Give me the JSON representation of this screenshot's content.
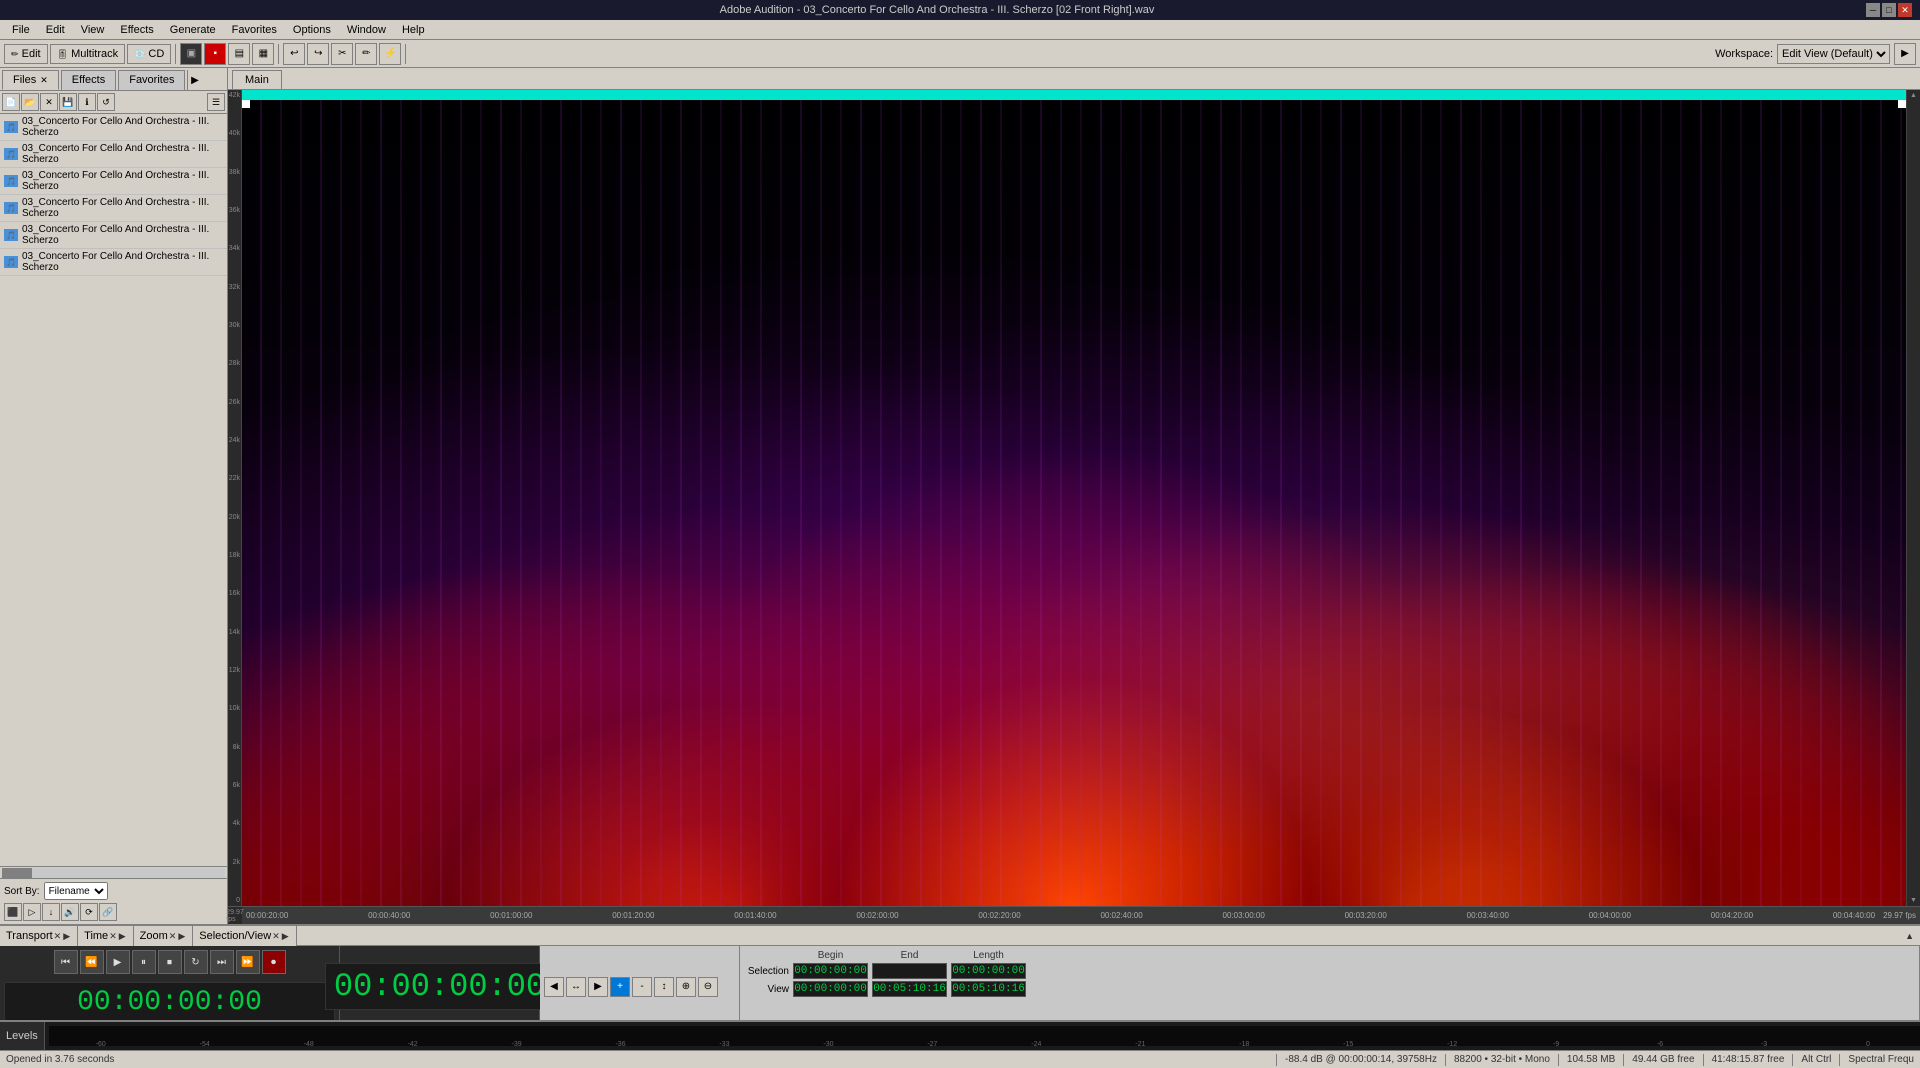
{
  "window": {
    "title": "Adobe Audition - 03_Concerto For Cello And Orchestra - III. Scherzo [02 Front Right].wav",
    "minimize": "─",
    "maximize": "□",
    "close": "✕"
  },
  "menu": {
    "items": [
      "File",
      "Edit",
      "View",
      "Effects",
      "Generate",
      "Favorites",
      "Options",
      "Window",
      "Help"
    ]
  },
  "toolbar": {
    "mode_edit": "Edit",
    "mode_multitrack": "Multitrack",
    "mode_cd": "CD",
    "workspace_label": "Workspace:",
    "workspace_value": "Edit View (Default)"
  },
  "panel": {
    "tabs": [
      {
        "label": "Files",
        "closeable": true
      },
      {
        "label": "Effects",
        "closeable": false
      },
      {
        "label": "Favorites",
        "closeable": false
      }
    ],
    "sort_label": "Sort By:",
    "sort_value": "Filename",
    "files": [
      "03_Concerto For Cello And Orchestra - III. Scherzo",
      "03_Concerto For Cello And Orchestra - III. Scherzo",
      "03_Concerto For Cello And Orchestra - III. Scherzo",
      "03_Concerto For Cello And Orchestra - III. Scherzo",
      "03_Concerto For Cello And Orchestra - III. Scherzo",
      "03_Concerto For Cello And Orchestra - III. Scherzo"
    ]
  },
  "waveform": {
    "main_tab": "Main",
    "fps_left": "29.97 fps",
    "fps_right": "29.97 fps",
    "time_marks": [
      "00:00:20:00",
      "00:00:40:00",
      "00:01:00:00",
      "00:01:20:00",
      "00:01:40:00",
      "00:02:00:00",
      "00:02:20:00",
      "00:02:40:00",
      "00:03:00:00",
      "00:03:20:00",
      "00:03:40:00",
      "00:04:00:00",
      "00:04:20:00",
      "00:04:40:00"
    ],
    "freq_labels": [
      "42000",
      "40000",
      "38000",
      "36000",
      "34000",
      "32000",
      "30000",
      "28000",
      "26000",
      "24000",
      "22000",
      "20000",
      "18000",
      "16000",
      "14000",
      "12000",
      "10000",
      "8000",
      "6000",
      "4000",
      "2000",
      "0"
    ]
  },
  "transport": {
    "panel_label": "Transport",
    "timecode": "00:00:00:00",
    "buttons": [
      "⏮",
      "⏪",
      "▶",
      "⏸",
      "⏹",
      "⏺",
      "⏭",
      "⏩"
    ]
  },
  "time": {
    "panel_label": "Time",
    "display": "00:00:00:00"
  },
  "zoom": {
    "panel_label": "Zoom",
    "buttons": [
      "◀",
      "↔",
      "▶",
      "⊕",
      "⊖",
      "↕",
      "⊕",
      "⊖"
    ]
  },
  "selection_view": {
    "panel_label": "Selection/View",
    "headers": [
      "Begin",
      "End",
      "Length"
    ],
    "rows": [
      {
        "label": "Selection",
        "begin": "00:00:00:00",
        "end": "",
        "length": "00:00:00:00"
      },
      {
        "label": "View",
        "begin": "00:00:00:00",
        "end": "00:05:10:16",
        "length": "00:05:10:16"
      }
    ]
  },
  "levels": {
    "panel_label": "Levels",
    "scale": [
      "-60",
      "-54",
      "-48",
      "-42",
      "-39",
      "-36",
      "-33",
      "-30",
      "-27",
      "-24",
      "-21",
      "-18",
      "-15",
      "-12",
      "-9",
      "-6",
      "-3",
      "0"
    ]
  },
  "status": {
    "opened_message": "Opened in 3.76 seconds",
    "db_info": "-88.4 dB @ 00:00:00:14, 39758Hz",
    "sample_rate": "88200 • 32-bit • Mono",
    "file_size": "104.58 MB",
    "disk_free": "49.44 GB free",
    "time_display": "41:48:15.87 free",
    "view_type": "Alt Ctrl",
    "spectral": "Spectral Frequ"
  }
}
